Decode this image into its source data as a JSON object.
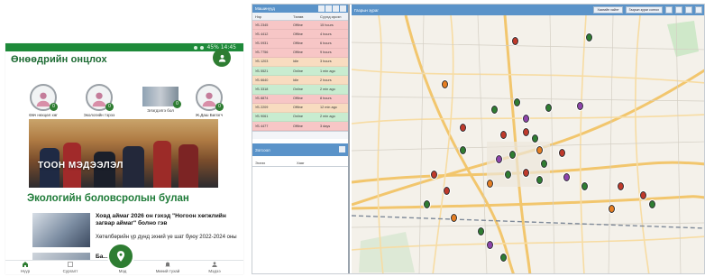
{
  "phone": {
    "status_text": "45% 14:45",
    "section_title": "Өнөөдрийн онцлох",
    "avatars": [
      {
        "name": "Өвч нөхцөл хөг",
        "count": "0"
      },
      {
        "name": "Экологийн тэрээ",
        "count": "0"
      },
      {
        "name": "Элэгдэлгэ бол",
        "count": "0"
      },
      {
        "name": "Ж.Даш Билэгч",
        "count": "0"
      }
    ],
    "banner_text": "ТООН МЭДЭЭЛЭЛ",
    "eco_title": "Экологийн боловсролын булан",
    "news": [
      {
        "headline": "Ховд аймаг 2026 он гэхэд \"Ногоон хөгжлийн загвар аймаг\" болно гэв",
        "subtext": "Хөтөлбөрийн үр дүнд эхний үе шат буюу 2022-2024 оны"
      },
      {
        "headline": "Ба...        , алсал"
      }
    ],
    "nav": [
      {
        "label": "Нүүр",
        "icon": "home-icon"
      },
      {
        "label": "Сургалт",
        "icon": "book-icon"
      },
      {
        "label": "Мэд",
        "icon": "map-icon"
      },
      {
        "label": "Миний тухай",
        "icon": "bell-icon"
      },
      {
        "label": "Мэдээ",
        "icon": "user-icon"
      }
    ]
  },
  "dashboard": {
    "vehicles_title": "Машинууд",
    "columns": [
      "Нэр",
      "Төлөв",
      "Сүүлд ирсэн"
    ],
    "rows": [
      {
        "id": "УБ 2345",
        "status": "Offline",
        "time": "15 hours",
        "color": "red"
      },
      {
        "id": "УБ 4412",
        "status": "Offline",
        "time": "4 hours",
        "color": "red"
      },
      {
        "id": "УБ 0931",
        "status": "Offline",
        "time": "6 hours",
        "color": "red"
      },
      {
        "id": "УБ 7756",
        "status": "Offline",
        "time": "9 hours",
        "color": "red"
      },
      {
        "id": "УБ 1203",
        "status": "Idle",
        "time": "3 hours",
        "color": "orange"
      },
      {
        "id": "УБ 5521",
        "status": "Online",
        "time": "1 min ago",
        "color": "green"
      },
      {
        "id": "УБ 6640",
        "status": "Idle",
        "time": "2 hours",
        "color": "orange"
      },
      {
        "id": "УБ 3318",
        "status": "Online",
        "time": "2 min ago",
        "color": "green"
      },
      {
        "id": "УБ 8874",
        "status": "Offline",
        "time": "8 hours",
        "color": "red"
      },
      {
        "id": "УБ 2209",
        "status": "Offline",
        "time": "12 min ago",
        "color": "orange"
      },
      {
        "id": "УБ 9061",
        "status": "Online",
        "time": "2 min ago",
        "color": "green"
      },
      {
        "id": "УБ 4477",
        "status": "Offline",
        "time": "3 days",
        "color": "red"
      }
    ],
    "stops_title": "Зогсоол",
    "stops_columns": [
      "Эхлэх",
      "Хаяг"
    ],
    "map_title": "Газрын зураг",
    "map_buttons": [
      "Хаягийн хайлт",
      "Газрын зураг сонгох"
    ]
  },
  "colors": {
    "phone_green": "#2e7d32",
    "pane_blue": "#5a93c9",
    "row_red": "#f7c6c6",
    "row_green": "#c8ecd0",
    "row_orange": "#f8dcc0"
  }
}
